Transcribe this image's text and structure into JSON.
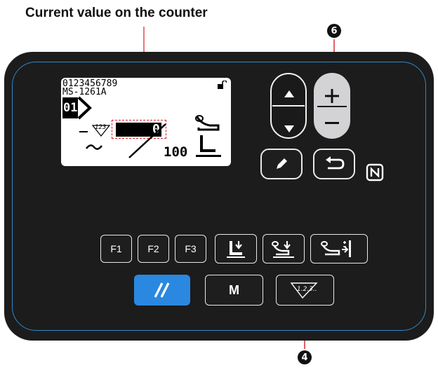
{
  "caption": "Current value on the counter",
  "markers": {
    "top": "6",
    "bottom": "4"
  },
  "lcd": {
    "line1": "0123456789",
    "line2": "MS-1261A",
    "pattern_no": "01",
    "counter_label": "123",
    "counter_value": "0",
    "counter_total": "100"
  },
  "keys": {
    "f1": "F1",
    "f2": "F2",
    "f3": "F3",
    "mode": "M",
    "counter_key": "1.2.3.."
  },
  "colors": {
    "accent_blue": "#2a88e0",
    "panel_border": "#2f87c8",
    "callout_red": "#d61f26"
  }
}
